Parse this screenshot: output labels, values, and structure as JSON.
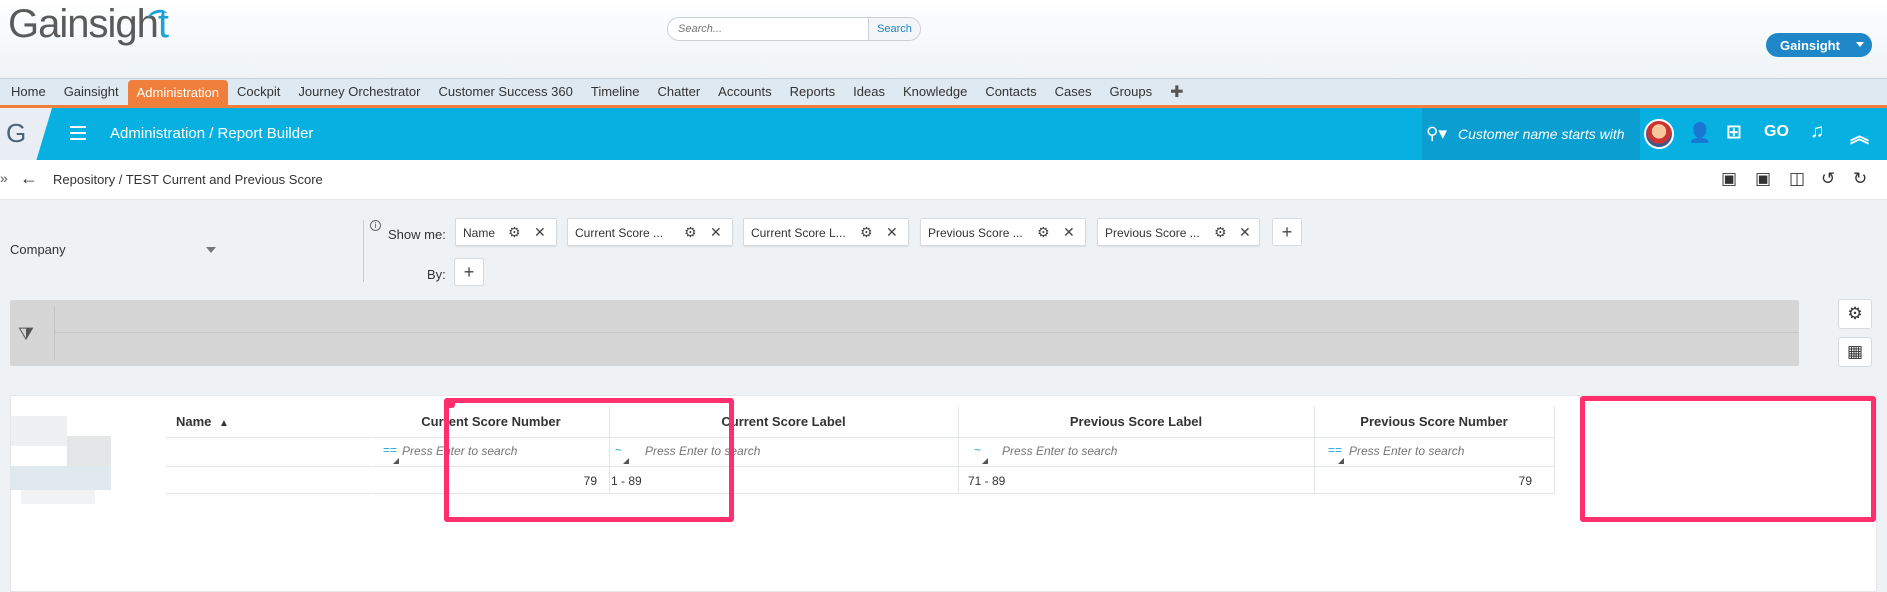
{
  "brand": {
    "logo_main": "Gainsigh",
    "logo_accent": "t"
  },
  "header": {
    "search_placeholder": "Search...",
    "search_button": "Search",
    "account_label": "Gainsight"
  },
  "nav": {
    "items": [
      "Home",
      "Gainsight",
      "Administration",
      "Cockpit",
      "Journey Orchestrator",
      "Customer Success 360",
      "Timeline",
      "Chatter",
      "Accounts",
      "Reports",
      "Ideas",
      "Knowledge",
      "Contacts",
      "Cases",
      "Groups"
    ],
    "active": "Administration",
    "add_symbol": "✚"
  },
  "app_bar": {
    "badge": "G",
    "title": "Administration / Report Builder",
    "search_hint": "Customer name starts with"
  },
  "breadcrumb": {
    "path": "Repository / TEST Current and Previous Score"
  },
  "config": {
    "object": "Company",
    "show_me_label": "Show me:",
    "by_label": "By:",
    "chips": [
      "Name",
      "Current Score ...",
      "Current Score L...",
      "Previous Score ...",
      "Previous Score ..."
    ]
  },
  "grid": {
    "columns": [
      {
        "header": "Name",
        "sorted": "asc",
        "filter_placeholder": ""
      },
      {
        "header": "Current Score Number",
        "filter_op": "==",
        "filter_placeholder": "Press Enter to search"
      },
      {
        "header": "Current Score Label",
        "filter_op": "~",
        "filter_placeholder": "Press Enter to search"
      },
      {
        "header": "Previous Score Label",
        "filter_op": "~",
        "filter_placeholder": "Press Enter to search"
      },
      {
        "header": "Previous Score Number",
        "filter_op": "==",
        "filter_placeholder": "Press Enter to search"
      }
    ],
    "rows": [
      {
        "name": "",
        "current_score_number": "79",
        "current_score_label": "1 - 89",
        "previous_score_label": "71 - 89",
        "previous_score_number": "79"
      }
    ]
  },
  "colors": {
    "accent_blue": "#06b1e2",
    "nav_active": "#f07f3c",
    "highlight": "#ff2f6d"
  }
}
